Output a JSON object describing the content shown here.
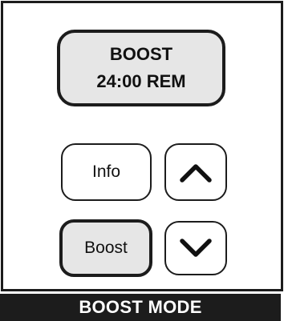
{
  "display": {
    "mode_line": "BOOST",
    "time_line": "24:00 REM"
  },
  "buttons": {
    "info_label": "Info",
    "boost_label": "Boost",
    "up_icon": "chevron-up-icon",
    "down_icon": "chevron-down-icon",
    "active": "boost"
  },
  "footer": {
    "label": "BOOST MODE"
  },
  "colors": {
    "outline": "#1c1c1c",
    "display_bg": "#e6e6e6",
    "active_button_bg": "#e6e6e6",
    "footer_bg": "#1c1c1c",
    "footer_text": "#ffffff"
  }
}
